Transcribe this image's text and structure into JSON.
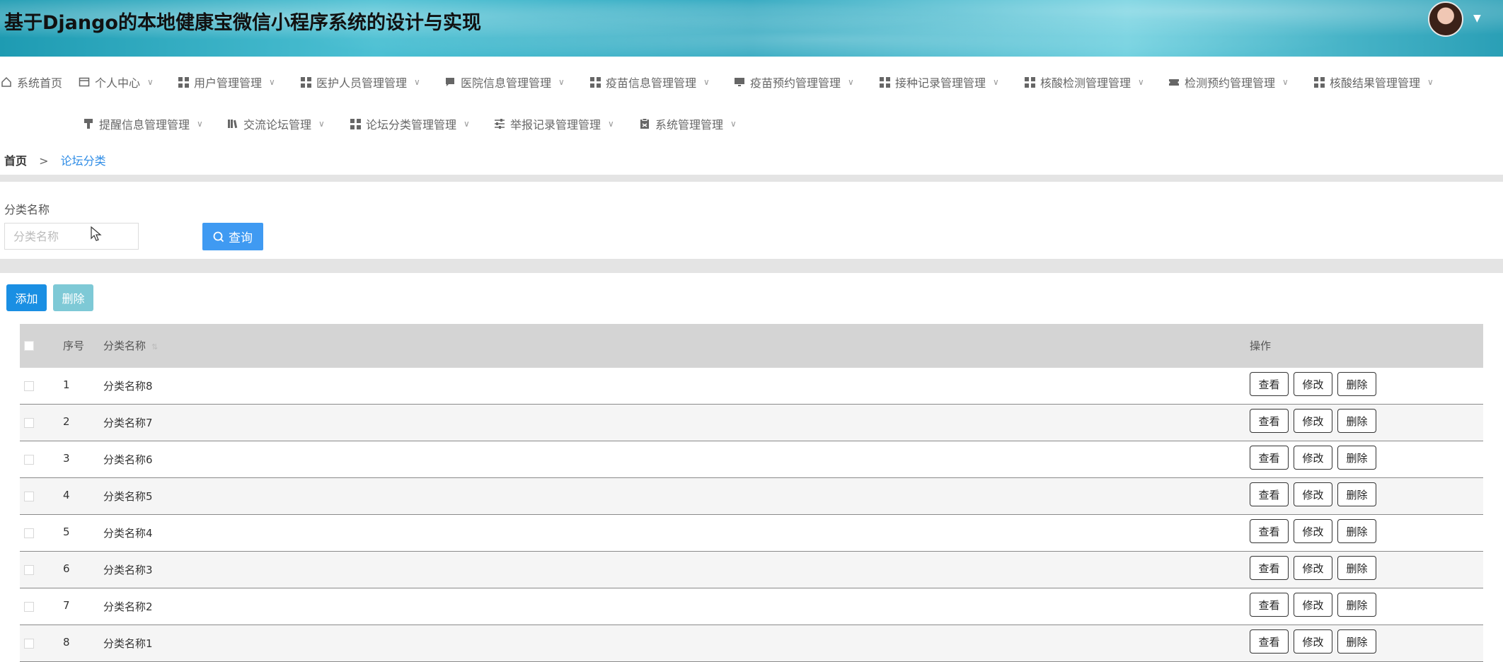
{
  "header": {
    "title": "基于Django的本地健康宝微信小程序系统的设计与实现",
    "avatar_caret": "▼"
  },
  "nav": {
    "row1": [
      {
        "label": "系统首页",
        "icon": "home-icon"
      },
      {
        "label": "个人中心",
        "icon": "card-icon"
      },
      {
        "label": "用户管理管理",
        "icon": "grid-icon"
      },
      {
        "label": "医护人员管理管理",
        "icon": "grid-icon"
      },
      {
        "label": "医院信息管理管理",
        "icon": "chat-icon"
      },
      {
        "label": "疫苗信息管理管理",
        "icon": "grid-icon"
      },
      {
        "label": "疫苗预约管理管理",
        "icon": "monitor-icon"
      },
      {
        "label": "接种记录管理管理",
        "icon": "grid-icon"
      },
      {
        "label": "核酸检测管理管理",
        "icon": "grid-icon"
      },
      {
        "label": "检测预约管理管理",
        "icon": "ticket-icon"
      },
      {
        "label": "核酸结果管理管理",
        "icon": "grid-icon"
      }
    ],
    "row2": [
      {
        "label": "提醒信息管理管理",
        "icon": "brush-icon"
      },
      {
        "label": "交流论坛管理",
        "icon": "books-icon"
      },
      {
        "label": "论坛分类管理管理",
        "icon": "grid-icon"
      },
      {
        "label": "举报记录管理管理",
        "icon": "sliders-icon"
      },
      {
        "label": "系统管理管理",
        "icon": "clipboard-icon"
      }
    ]
  },
  "breadcrumb": {
    "home": "首页",
    "separator": ">",
    "current": "论坛分类"
  },
  "search": {
    "label": "分类名称",
    "placeholder": "分类名称",
    "button_label": "查询"
  },
  "actions": {
    "add_label": "添加",
    "delete_label": "删除"
  },
  "table": {
    "headers": {
      "index": "序号",
      "name": "分类名称",
      "operation": "操作"
    },
    "rows": [
      {
        "index": "1",
        "name": "分类名称8"
      },
      {
        "index": "2",
        "name": "分类名称7"
      },
      {
        "index": "3",
        "name": "分类名称6"
      },
      {
        "index": "4",
        "name": "分类名称5"
      },
      {
        "index": "5",
        "name": "分类名称4"
      },
      {
        "index": "6",
        "name": "分类名称3"
      },
      {
        "index": "7",
        "name": "分类名称2"
      },
      {
        "index": "8",
        "name": "分类名称1"
      }
    ],
    "row_buttons": {
      "view": "查看",
      "edit": "修改",
      "delete": "删除"
    }
  },
  "colors": {
    "primary": "#1a8fe3",
    "query_button": "#3f9af2",
    "delete_disabled": "#7ec9d6",
    "breadcrumb_active": "#2e8ce6",
    "table_header_bg": "#d4d4d4"
  }
}
